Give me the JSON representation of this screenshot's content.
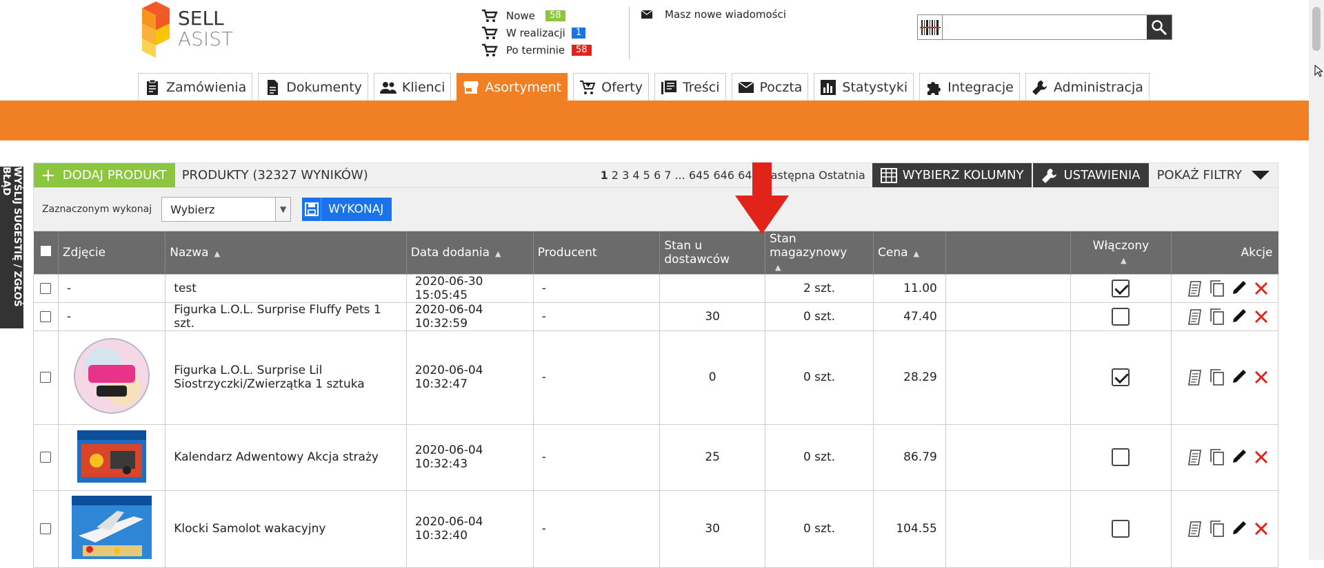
{
  "logo": {
    "line1": "SELL",
    "line2": "ASIST"
  },
  "orders": [
    {
      "label": "Nowe",
      "count": "58",
      "color": "#8cc63f"
    },
    {
      "label": "W realizacji",
      "count": "1",
      "color": "#1a73e8"
    },
    {
      "label": "Po terminie",
      "count": "58",
      "color": "#e2231a"
    }
  ],
  "messages": {
    "label": "Masz nowe wiadomości"
  },
  "search": {
    "value": "",
    "placeholder": ""
  },
  "nav": [
    {
      "label": "Zamówienia",
      "icon": "clipboard-icon"
    },
    {
      "label": "Dokumenty",
      "icon": "document-icon"
    },
    {
      "label": "Klienci",
      "icon": "people-icon"
    },
    {
      "label": "Asortyment",
      "icon": "store-icon",
      "active": true
    },
    {
      "label": "Oferty",
      "icon": "cart-icon"
    },
    {
      "label": "Treści",
      "icon": "articles-icon"
    },
    {
      "label": "Poczta",
      "icon": "mail-icon"
    },
    {
      "label": "Statystyki",
      "icon": "chart-icon"
    },
    {
      "label": "Integracje",
      "icon": "puzzle-icon"
    },
    {
      "label": "Administracja",
      "icon": "wrench-icon"
    }
  ],
  "feedback": {
    "label": "WYŚLIJ SUGESTIĘ / ZGŁOŚ BŁĄD"
  },
  "toolbar": {
    "add_label": "DODAJ PRODUKT",
    "title": "PRODUKTY (32327 WYNIKÓW)",
    "pager": {
      "current": "1",
      "pages": "2 3 4 5 6 7 ... 645 646 647",
      "next": "Następna",
      "last": "Ostatnia"
    },
    "columns_label": "WYBIERZ KOLUMNY",
    "settings_label": "USTAWIENIA",
    "filters_label": "POKAŻ FILTRY"
  },
  "bulk": {
    "label": "Zaznaczonym wykonaj",
    "selected": "Wybierz",
    "execute_label": "WYKONAJ"
  },
  "table": {
    "headers": {
      "photo": "Zdjęcie",
      "name": "Nazwa",
      "date": "Data dodania",
      "producer": "Producent",
      "supplier_stock": "Stan u dostawców",
      "stock": "Stan magazynowy",
      "price": "Cena",
      "blank": "",
      "enabled": "Włączony",
      "actions": "Akcje"
    },
    "rows": [
      {
        "photo": "-",
        "name": "test",
        "date": "2020-06-30 15:05:45",
        "producer": "-",
        "supplier_stock": "",
        "stock": "2 szt.",
        "price": "11.00",
        "enabled": true
      },
      {
        "photo": "-",
        "name": "Figurka L.O.L. Surprise Fluffy Pets 1 szt.",
        "date": "2020-06-04 10:32:59",
        "producer": "-",
        "supplier_stock": "30",
        "stock": "0 szt.",
        "price": "47.40",
        "enabled": false
      },
      {
        "photo": "lol-ball-image",
        "name": "Figurka L.O.L. Surprise Lil Siostrzyczki/Zwierzątka 1 sztuka",
        "date": "2020-06-04 10:32:47",
        "producer": "-",
        "supplier_stock": "0",
        "stock": "0 szt.",
        "price": "28.29",
        "enabled": true
      },
      {
        "photo": "playmobil-box-image",
        "name": "Kalendarz Adwentowy Akcja straży",
        "date": "2020-06-04 10:32:43",
        "producer": "-",
        "supplier_stock": "25",
        "stock": "0 szt.",
        "price": "86.79",
        "enabled": false
      },
      {
        "photo": "playmobil-plane-image",
        "name": "Klocki Samolot wakacyjny",
        "date": "2020-06-04 10:32:40",
        "producer": "-",
        "supplier_stock": "30",
        "stock": "0 szt.",
        "price": "104.55",
        "enabled": false
      }
    ]
  },
  "colors": {
    "accent": "#f08023",
    "green": "#8cc63f",
    "blue": "#1a73e8",
    "header_gray": "#6b6b6b",
    "delete_red": "#e2231a"
  }
}
